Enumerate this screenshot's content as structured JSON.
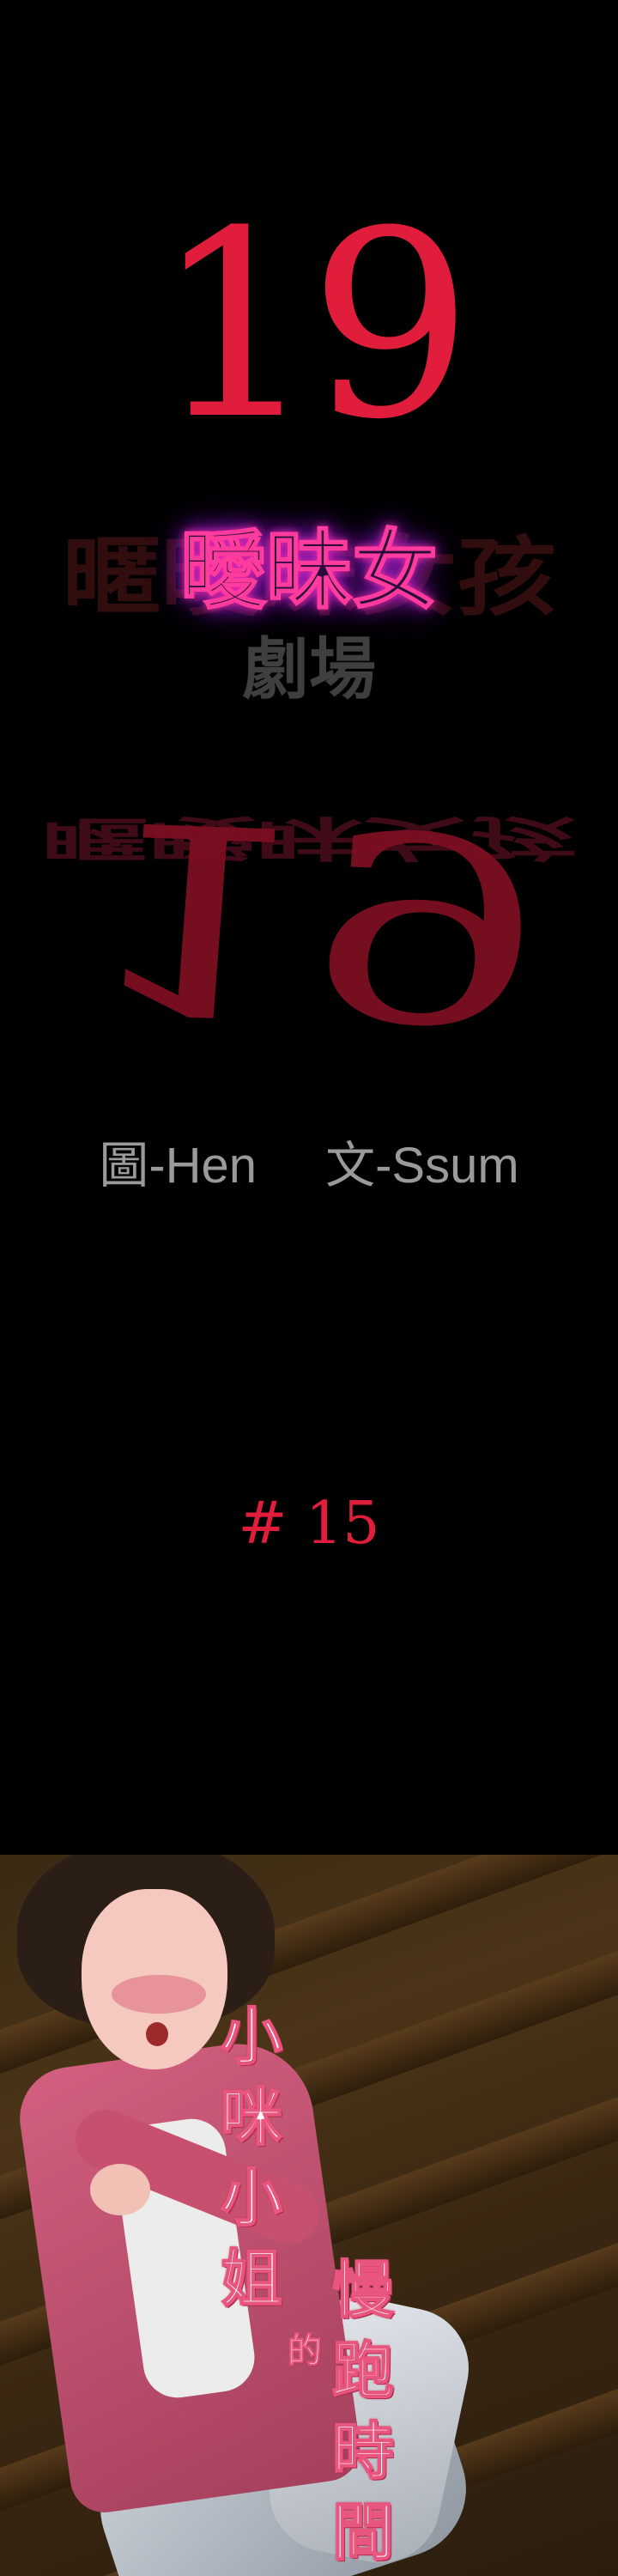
{
  "cover": {
    "number": "19",
    "subtitle": "曖昧女",
    "subtitle_echo": "暱曖昧女孩",
    "theatre": "劇場",
    "reflection_text": "暱曖昧女孩"
  },
  "credits": {
    "art": "圖-Hen",
    "story": "文-Ssum"
  },
  "episode": {
    "label": "# 15"
  },
  "chapter_title": {
    "column1": [
      "小",
      "咪",
      "小",
      "姐"
    ],
    "particle": "的",
    "column2": [
      "慢",
      "跑",
      "時",
      "間"
    ]
  },
  "colors": {
    "background": "#000000",
    "title_red": "#e11d3c",
    "neon_pink": "#ff3b9d",
    "credit_gray": "#9a9a9a"
  }
}
